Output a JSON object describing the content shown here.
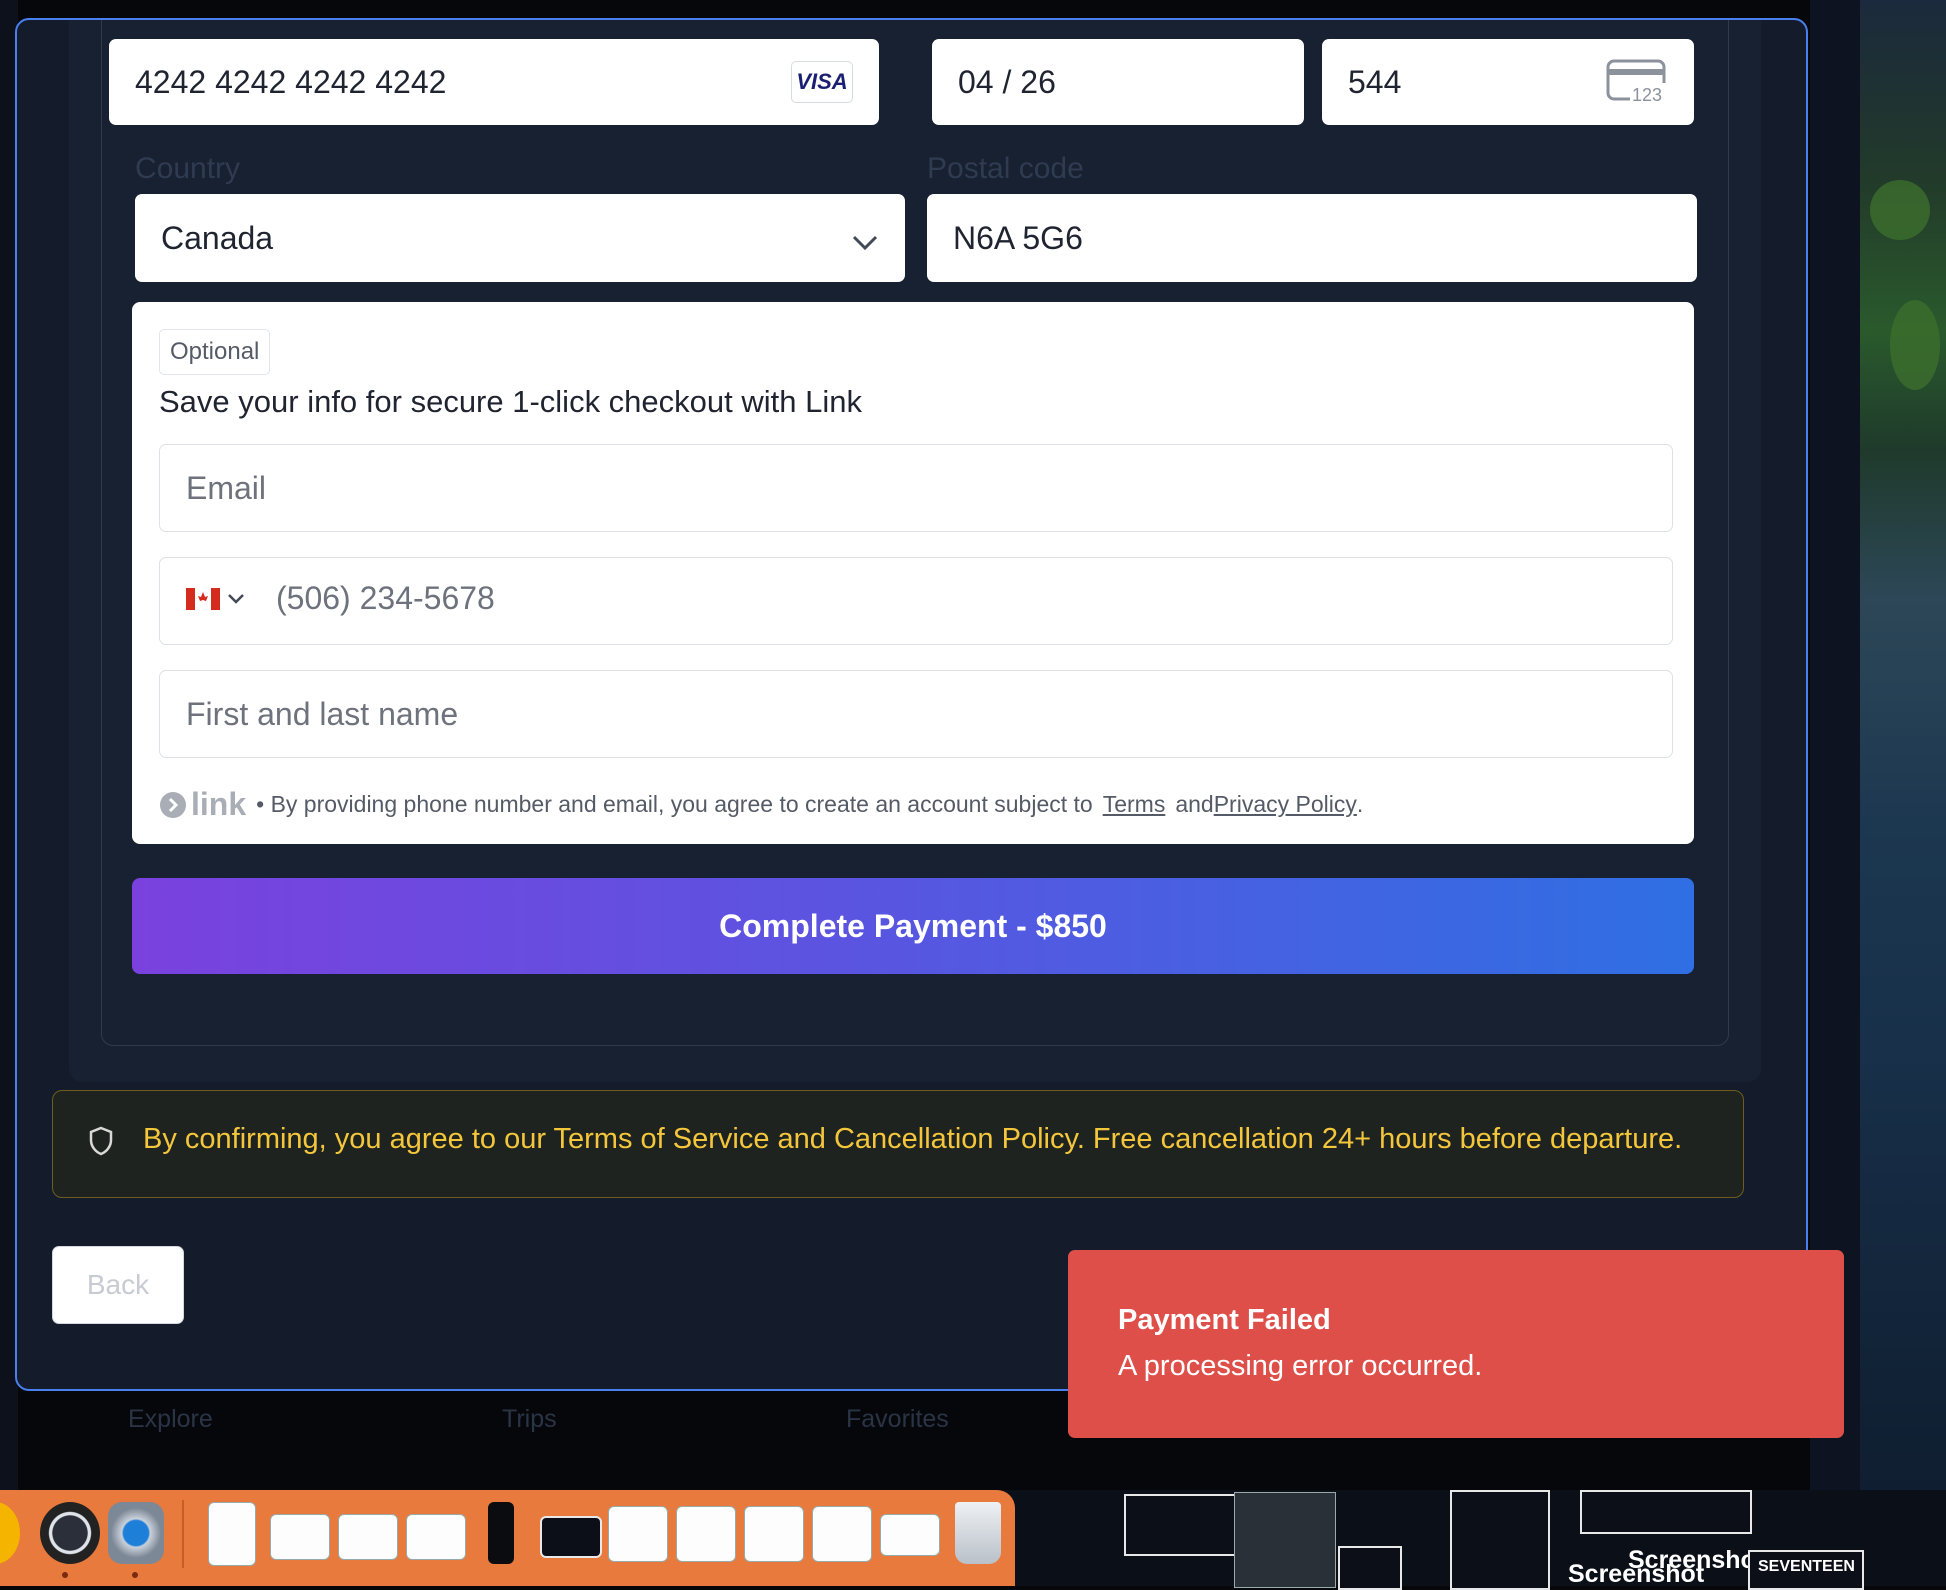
{
  "payment_form": {
    "card_number": "4242 4242 4242 4242",
    "card_brand": "VISA",
    "expiry": "04 / 26",
    "cvc": "544",
    "cvc_icon_text": "123",
    "country_label": "Country",
    "country_value": "Canada",
    "postal_label": "Postal code",
    "postal_value": "N6A 5G6"
  },
  "link_section": {
    "optional_badge": "Optional",
    "heading": "Save your info for secure 1-click checkout with Link",
    "email_placeholder": "Email",
    "phone_placeholder": "(506) 234-5678",
    "name_placeholder": "First and last name",
    "logo_text": "link",
    "legal_prefix": "• By providing phone number and email, you agree to create an account subject to",
    "terms_link": "Terms",
    "and_text": "and",
    "privacy_link": "Privacy Policy",
    "period": "."
  },
  "pay_button_label": "Complete Payment - $850",
  "notice_text": "By confirming, you agree to our Terms of Service and Cancellation Policy. Free cancellation 24+ hours before departure.",
  "back_button_label": "Back",
  "bottom_nav": [
    "Explore",
    "Trips",
    "Favorites"
  ],
  "toast": {
    "title": "Payment Failed",
    "message": "A processing error occurred."
  },
  "desktop": {
    "screenshot_label_1": "Screenshot",
    "screenshot_label_2": "Screenshot",
    "seventeen_label": "SEVENTEEN"
  },
  "colors": {
    "accent_border": "#4a7ff0",
    "button_gradient_start": "#7a41df",
    "button_gradient_end": "#2f6fe3",
    "notice_text": "#f3c63c",
    "toast_bg": "#de4f4a"
  }
}
